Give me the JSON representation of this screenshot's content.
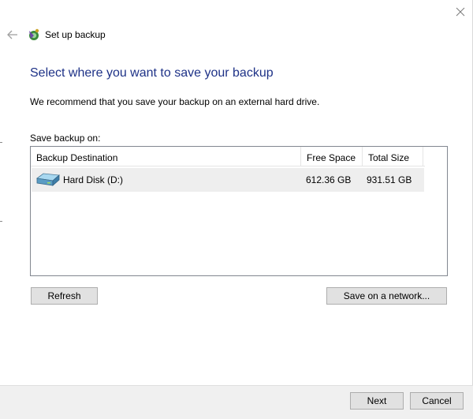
{
  "window": {
    "title": "Set up backup",
    "close_icon": "close-icon",
    "back_icon": "back-arrow-icon",
    "app_icon": "backup-icon"
  },
  "main": {
    "heading": "Select where you want to save your backup",
    "recommendation": "We recommend that you save your backup on an external hard drive.",
    "save_on_label": "Save backup on:"
  },
  "table": {
    "columns": [
      "Backup Destination",
      "Free Space",
      "Total Size"
    ],
    "rows": [
      {
        "icon": "hard-drive-icon",
        "destination": "Hard Disk (D:)",
        "free_space": "612.36 GB",
        "total_size": "931.51 GB"
      }
    ]
  },
  "buttons": {
    "refresh": "Refresh",
    "save_on_network": "Save on a network...",
    "next": "Next",
    "cancel": "Cancel"
  },
  "colors": {
    "heading": "#1e3287",
    "footer_bg": "#f0f0f0",
    "button_bg": "#e1e1e1",
    "selected_row": "#eeeeee"
  }
}
